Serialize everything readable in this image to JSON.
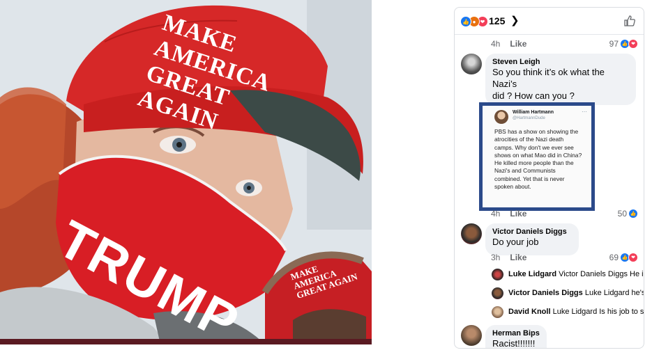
{
  "photo": {
    "hat_front_text": "MAKE AMERICA GREAT AGAIN",
    "mask_text": "TRUMP",
    "hat_side_text": "MAKE AMERICA GREAT AGAIN"
  },
  "panel": {
    "reactions": [
      "like",
      "angry",
      "love"
    ],
    "reaction_count": "125",
    "colors": {
      "like": "#1877f2",
      "love": "#f33e58",
      "angry": "#e9710f",
      "text_secondary": "#65676b"
    },
    "comments": [
      {
        "time": "4h",
        "like_label": "Like",
        "reaction_count": "97"
      },
      {
        "author": "Steven Leigh",
        "text_line1": "So you think it’s ok what the Nazi’s",
        "text_line2": "did ? How can you ?",
        "tweet": {
          "name": "William Hartmann",
          "handle": "@HartmannDude",
          "text": "PBS has a show on showing the\natrocities of the Nazi death\ncamps. Why don't we ever see\nshows on what Mao did in China?\nHe killed more people than the\nNazi's and Communists\ncombined. Yet that is never\nspoken about."
        },
        "time": "4h",
        "like_label": "Like",
        "reaction_count": "50"
      },
      {
        "author": "Victor Daniels Diggs",
        "text": "Do your job",
        "time": "3h",
        "like_label": "Like",
        "reaction_count": "69",
        "replies": [
          {
            "author": "Luke Lidgard",
            "text": "Victor Daniels Diggs He i..."
          },
          {
            "author": "Victor Daniels Diggs",
            "text": "Luke Lidgard he's..."
          },
          {
            "author": "David Knoll",
            "text": "Luke Lidgard Is his job to s..."
          }
        ]
      },
      {
        "author": "Herman Bips",
        "text": "Racist!!!!!!!"
      }
    ]
  }
}
